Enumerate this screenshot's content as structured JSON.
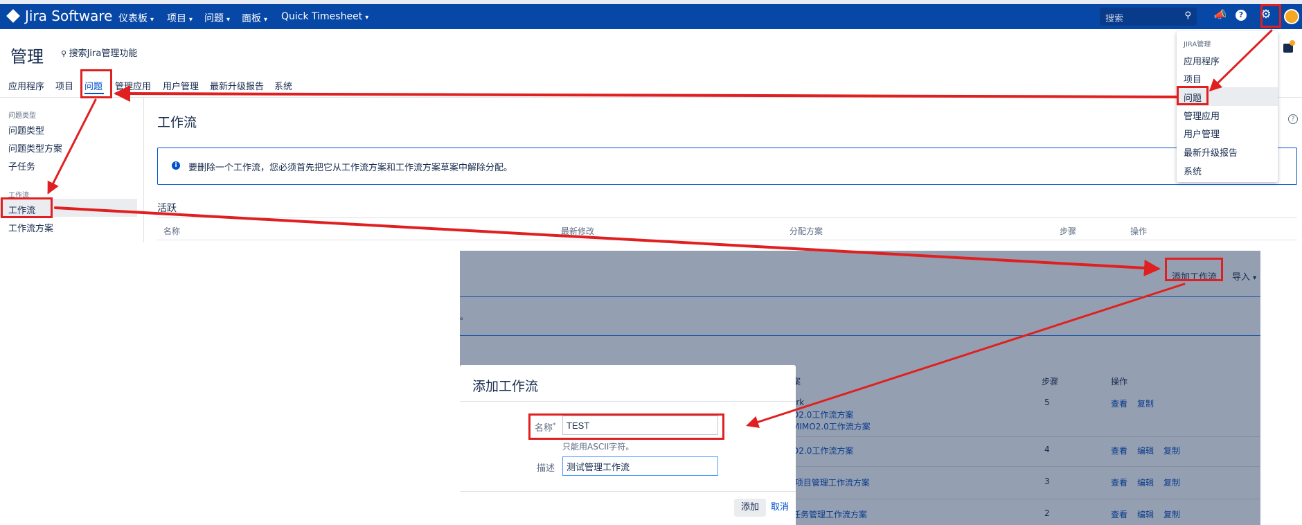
{
  "app": {
    "brand": "Jira Software",
    "nav": [
      {
        "label": "仪表板"
      },
      {
        "label": "项目"
      },
      {
        "label": "问题"
      },
      {
        "label": "面板"
      },
      {
        "label": "Quick Timesheet"
      }
    ],
    "search_placeholder": "搜索"
  },
  "admin": {
    "title": "管理",
    "search_label": "搜索Jira管理功能",
    "tabs": [
      "应用程序",
      "项目",
      "问题",
      "管理应用",
      "用户管理",
      "最新升级报告",
      "系统"
    ],
    "active_tab": "问题"
  },
  "sidebar": {
    "group1_title": "问题类型",
    "group1_items": [
      "问题类型",
      "问题类型方案",
      "子任务"
    ],
    "group2_title": "工作流",
    "group2_items": [
      "工作流",
      "工作流方案"
    ]
  },
  "main": {
    "heading": "工作流",
    "info_message": "要删除一个工作流，您必须首先把它从工作流方案和工作流方案草案中解除分配。",
    "section_title": "活跃",
    "columns": [
      "名称",
      "最新修改",
      "分配方案",
      "步骤",
      "操作"
    ]
  },
  "admin_menu": {
    "header": "JIRA管理",
    "items": [
      "应用程序",
      "项目",
      "问题",
      "管理应用",
      "用户管理",
      "最新升级报告",
      "系统"
    ],
    "highlighted": "问题"
  },
  "overlay": {
    "add_workflow_button": "添加工作流",
    "import_button": "导入",
    "partial_text": "。",
    "columns": {
      "steps": "步骤",
      "actions": "操作",
      "schemes_partial": "案"
    },
    "rows": [
      {
        "schemes": [
          "ork",
          "D2.0工作流方案",
          "MIMO2.0工作流方案"
        ],
        "steps": "5",
        "actions": [
          "查看",
          "复制"
        ]
      },
      {
        "schemes": [
          "D2.0工作流方案"
        ],
        "steps": "4",
        "actions": [
          "查看",
          "编辑",
          "复制"
        ]
      },
      {
        "schemes": [
          ": 项目管理工作流方案"
        ],
        "steps": "3",
        "actions": [
          "查看",
          "编辑",
          "复制"
        ]
      },
      {
        "schemes": [
          "任务管理工作流方案"
        ],
        "steps": "2",
        "actions": [
          "查看",
          "编辑",
          "复制"
        ]
      }
    ]
  },
  "dialog": {
    "title": "添加工作流",
    "name_label": "名称",
    "required_mark": "*",
    "name_value": "TEST",
    "name_hint": "只能用ASCII字符。",
    "desc_label": "描述",
    "desc_value": "测试管理工作流",
    "submit_label": "添加",
    "cancel_label": "取消"
  },
  "colors": {
    "nav_bg": "#0747a6",
    "link": "#0052cc",
    "annotation_red": "#e02020",
    "overlay_bg": "#949fb1"
  }
}
